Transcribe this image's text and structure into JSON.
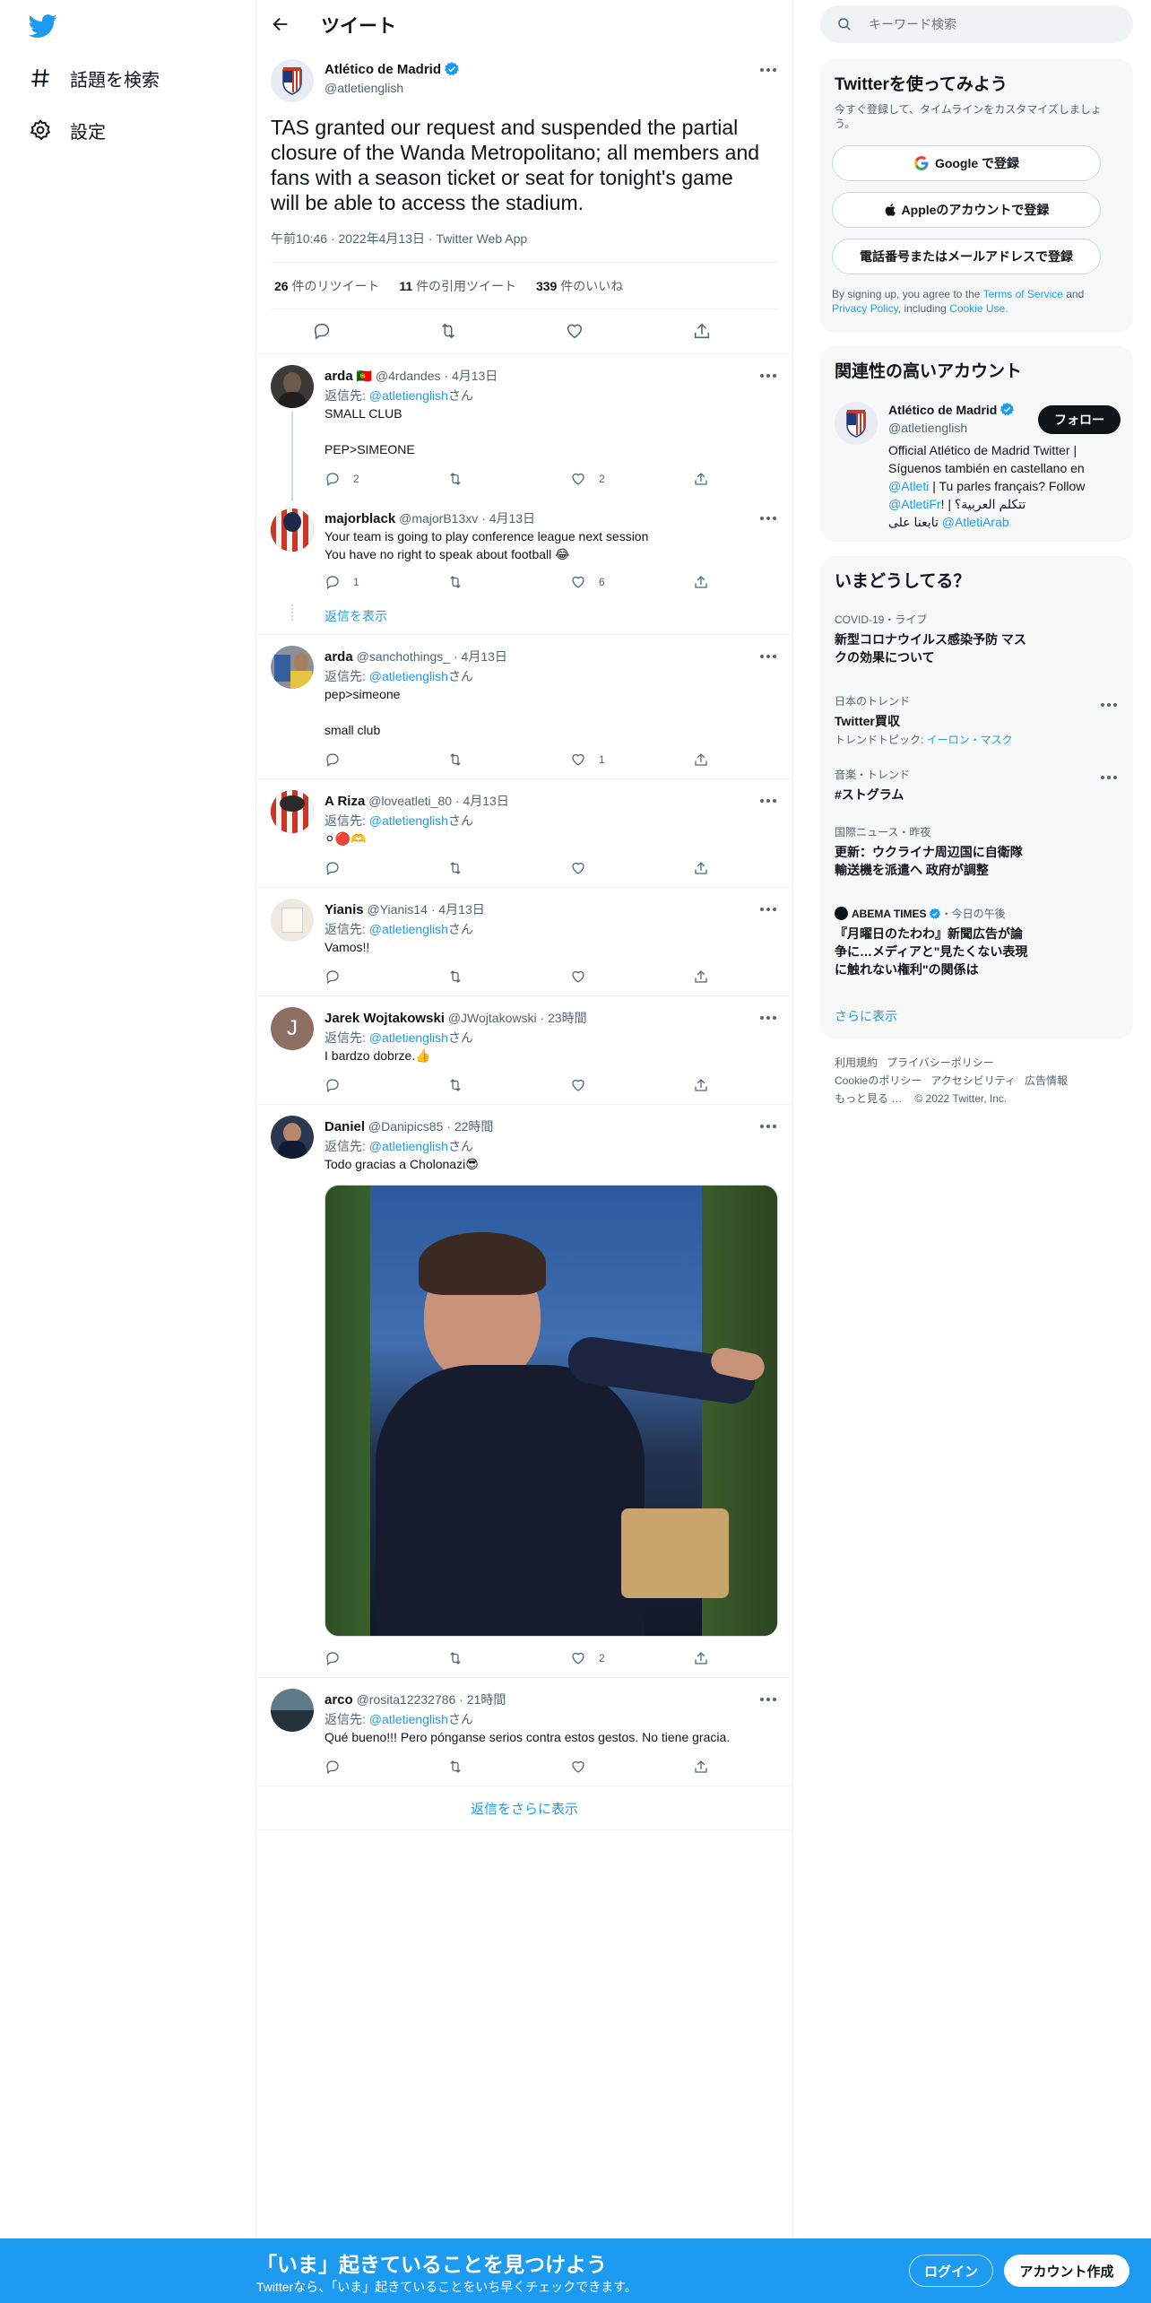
{
  "nav": {
    "explore_label": "話題を検索",
    "settings_label": "設定"
  },
  "header": {
    "title": "ツイート"
  },
  "tweet": {
    "author_name": "Atlético de Madrid",
    "author_handle": "@atletienglish",
    "text_lines": [
      "TAS granted our request and suspended the partial",
      "closure of the Wanda Metropolitano; all members and",
      "fans with a season ticket or seat for tonight's game",
      "will be able to access the stadium."
    ],
    "time": "午前10:46",
    "date": "2022年4月13日",
    "source": "Twitter Web App",
    "stats": {
      "retweets_count": "26",
      "retweets_label": "件のリツイート",
      "quotes_count": "11",
      "quotes_label": "件の引用ツイート",
      "likes_count": "339",
      "likes_label": "件のいいね"
    }
  },
  "replies": [
    {
      "name": "arda",
      "flag": "🇵🇹",
      "handle": "@4rdandes",
      "time": "4月13日",
      "reply_to_prefix": "返信先: ",
      "reply_to": "@atletienglish",
      "reply_to_suffix": "さん",
      "lines": [
        "SMALL CLUB",
        "",
        "PEP>SIMEONE"
      ],
      "replies": "2",
      "retweets": "",
      "likes": "2"
    },
    {
      "name": "majorblack",
      "handle": "@majorB13xv",
      "time": "4月13日",
      "lines": [
        "Your team is going to play conference league next session",
        "You have no right to speak about football 😂"
      ],
      "replies": "1",
      "retweets": "",
      "likes": "6"
    },
    {
      "name": "arda",
      "handle": "@sanchothings_",
      "time": "4月13日",
      "reply_to_prefix": "返信先: ",
      "reply_to": "@atletienglish",
      "reply_to_suffix": "さん",
      "lines": [
        "pep>simeone",
        "",
        "small club"
      ],
      "replies": "",
      "retweets": "",
      "likes": "1"
    },
    {
      "name": "A Riza",
      "handle": "@loveatleti_80",
      "time": "4月13日",
      "reply_to_prefix": "返信先: ",
      "reply_to": "@atletienglish",
      "reply_to_suffix": "さん",
      "lines": [
        "⚪🔴🫶"
      ],
      "replies": "",
      "retweets": "",
      "likes": ""
    },
    {
      "name": "Yianis",
      "handle": "@Yianis14",
      "time": "4月13日",
      "reply_to_prefix": "返信先: ",
      "reply_to": "@atletienglish",
      "reply_to_suffix": "さん",
      "lines": [
        "Vamos!!"
      ],
      "replies": "",
      "retweets": "",
      "likes": ""
    },
    {
      "name": "Jarek Wojtakowski",
      "handle": "@JWojtakowski",
      "time": "23時間",
      "avatar_letter": "J",
      "reply_to_prefix": "返信先: ",
      "reply_to": "@atletienglish",
      "reply_to_suffix": "さん",
      "lines": [
        "I bardzo dobrze.👍"
      ],
      "replies": "",
      "retweets": "",
      "likes": ""
    },
    {
      "name": "Daniel",
      "handle": "@Danipics85",
      "time": "22時間",
      "reply_to_prefix": "返信先: ",
      "reply_to": "@atletienglish",
      "reply_to_suffix": "さん",
      "lines": [
        "Todo gracias a Cholonazi😎"
      ],
      "replies": "",
      "retweets": "",
      "likes": "2"
    },
    {
      "name": "arco",
      "handle": "@rosita12232786",
      "time": "21時間",
      "reply_to_prefix": "返信先: ",
      "reply_to": "@atletienglish",
      "reply_to_suffix": "さん",
      "lines": [
        "Qué bueno!!! Pero pónganse serios contra estos gestos. No tiene gracia."
      ],
      "replies": "",
      "retweets": "",
      "likes": ""
    }
  ],
  "show_replies_label": "返信を表示",
  "more_replies_label": "返信をさらに表示",
  "search": {
    "placeholder": "キーワード検索"
  },
  "signup": {
    "title": "Twitterを使ってみよう",
    "subtitle_lines": [
      "今すぐ登録して、タイムラインをカスタマイズしましょ",
      "う。"
    ],
    "google_label": "Google で登録",
    "apple_label": "Appleのアカウントで登録",
    "phone_label": "電話番号またはメールアドレスで登録",
    "legal_prefix": "By signing up, you agree to the ",
    "terms": "Terms of Service",
    "and": " and",
    "privacy": "Privacy Policy",
    "including": ", including ",
    "cookie": "Cookie Use."
  },
  "related": {
    "title": "関連性の高いアカウント",
    "name": "Atlético de Madrid",
    "handle": "@atletienglish",
    "follow_label": "フォロー",
    "bio_lines": [
      "Official Atlético de Madrid Twitter |",
      "Síguenos también en castellano en"
    ],
    "bio_link1": "@Atleti",
    "bio_text3": " | Tu parles français? Follow",
    "bio_link2": "@AtletiFr",
    "bio_text4": "! | تتكلم العربية؟",
    "bio_arabic": "تابعنا على ",
    "bio_link3": "@AtletiArab"
  },
  "trends": {
    "title": "いまどうしてる？",
    "items": [
      {
        "meta": "COVID-19・ライブ",
        "title_lines": [
          "新型コロナウイルス感染予防 マス",
          "クの効果について"
        ]
      },
      {
        "meta": "日本のトレンド",
        "title_lines": [
          "Twitter買収"
        ],
        "sub_prefix": "トレンドトピック: ",
        "sub_link": "イーロン・マスク"
      },
      {
        "meta": "音楽・トレンド",
        "title_lines": [
          "#ストグラム"
        ]
      },
      {
        "meta": "国際ニュース・昨夜",
        "title_lines": [
          "更新：ウクライナ周辺国に自衛隊",
          "輸送機を派遣へ 政府が調整"
        ]
      },
      {
        "meta_source": "ABEMA TIMES",
        "meta_time": "・今日の午後",
        "title_lines": [
          "『月曜日のたわわ』新聞広告が論",
          "争に…メディアと\"見たくない表現",
          "に触れない権利\"の関係は"
        ]
      }
    ],
    "show_more": "さらに表示"
  },
  "footer": {
    "line1": [
      "利用規約",
      "プライバシーポリシー"
    ],
    "line2": [
      "Cookieのポリシー",
      "アクセシビリティ",
      "広告情報"
    ],
    "more": "もっと見る …",
    "copyright": "© 2022 Twitter, Inc."
  },
  "bottom_bar": {
    "title": "「いま」起きていることを見つけよう",
    "subtitle": "Twitterなら、「いま」起きていることをいち早くチェックできます。",
    "login_label": "ログイン",
    "signup_label": "アカウント作成"
  },
  "colors": {
    "accent": "#1d9bf0",
    "text": "#0f1419",
    "muted": "#536471",
    "border": "#eff3f4"
  }
}
